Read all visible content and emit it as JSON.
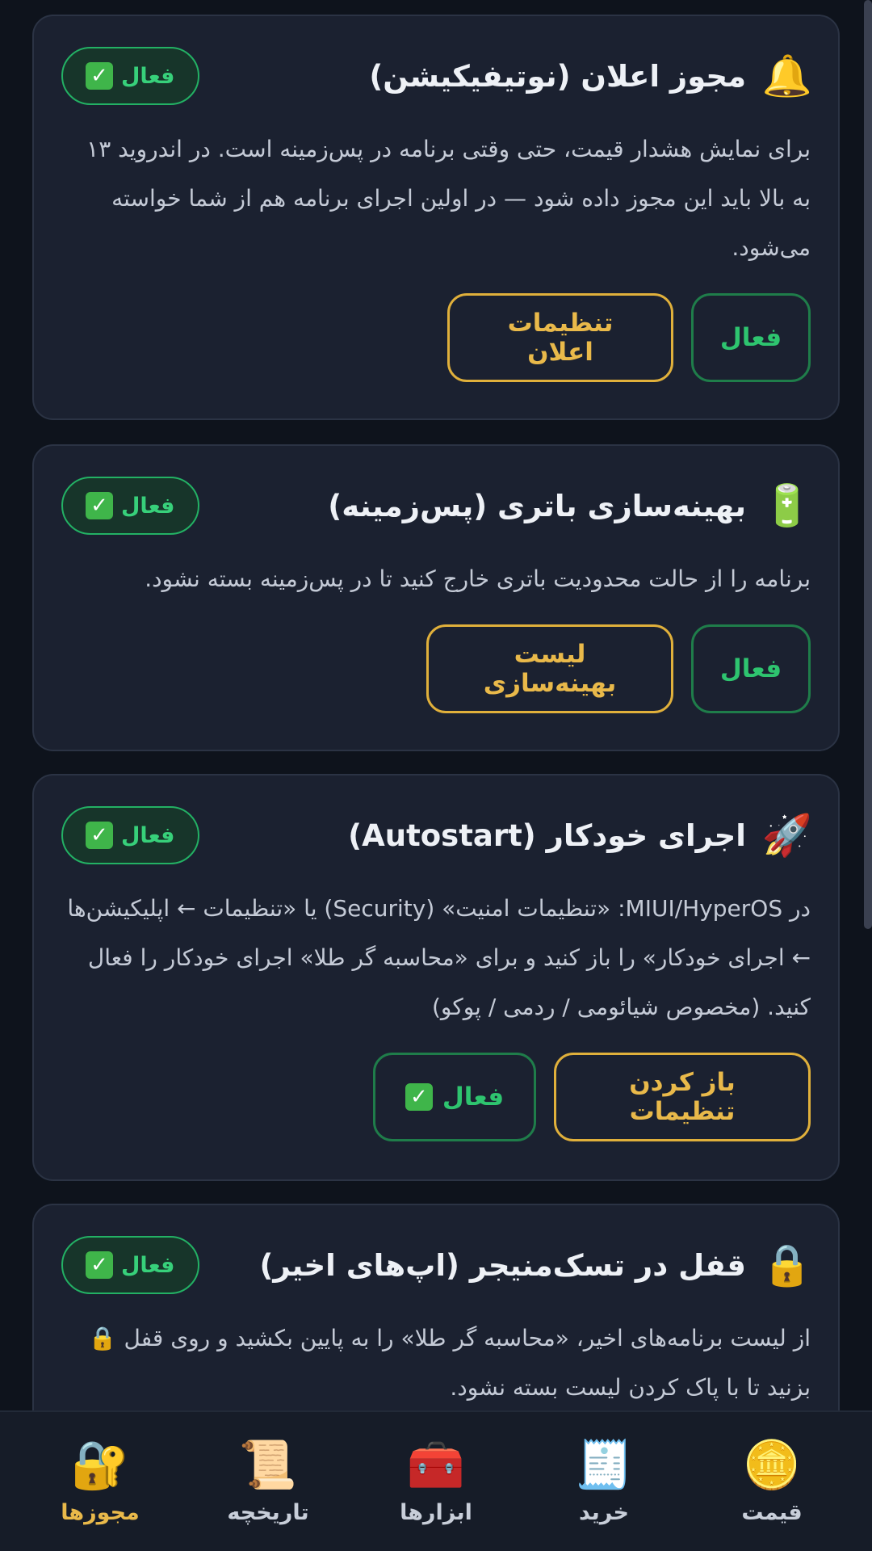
{
  "cards": [
    {
      "icon": "bell-icon",
      "icon_glyph": "🔔",
      "title": "مجوز اعلان (نوتیفیکیشن)",
      "badge": "فعال",
      "description": "برای نمایش هشدار قیمت، حتی وقتی برنامه در پس‌زمینه است. در اندروید ۱۳ به بالا باید این مجوز داده شود — در اولین اجرای برنامه هم از شما خواسته می‌شود.",
      "primary_button": "فعال",
      "secondary_button": "تنظیمات اعلان"
    },
    {
      "icon": "battery-icon",
      "icon_glyph": "🔋",
      "title": "بهینه‌سازی باتری (پس‌زمینه)",
      "badge": "فعال",
      "description": "برنامه را از حالت محدودیت باتری خارج کنید تا در پس‌زمینه بسته نشود.",
      "primary_button": "فعال",
      "secondary_button": "لیست بهینه‌سازی"
    },
    {
      "icon": "rocket-icon",
      "icon_glyph": "🚀",
      "title": "اجرای خودکار (Autostart)",
      "badge": "فعال",
      "description": "در MIUI/HyperOS: «تنظیمات امنیت» (Security) یا «تنظیمات ← اپلیکیشن‌ها ← اجرای خودکار» را باز کنید و برای «محاسبه گر طلا» اجرای خودکار را فعال کنید. (مخصوص شیائومی / ردمی / پوکو)",
      "primary_button": "باز کردن تنظیمات",
      "secondary_button": "فعال"
    },
    {
      "icon": "lock-icon",
      "icon_glyph": "🔒",
      "title": "قفل در تسک‌منیجر (اپ‌های اخیر)",
      "badge": "فعال",
      "description": "از لیست برنامه‌های اخیر، «محاسبه گر طلا» را به پایین بکشید و روی قفل 🔒 بزنید تا با پاک کردن لیست بسته نشود."
    }
  ],
  "nav": [
    {
      "label": "قیمت",
      "icon": "coin-icon",
      "glyph": "🪙"
    },
    {
      "label": "خرید",
      "icon": "receipt-icon",
      "glyph": "🧾"
    },
    {
      "label": "ابزارها",
      "icon": "toolbox-icon",
      "glyph": "🧰"
    },
    {
      "label": "تاریخچه",
      "icon": "scroll-icon",
      "glyph": "📜"
    },
    {
      "label": "مجوزها",
      "icon": "lock-key-icon",
      "glyph": "🔐"
    }
  ],
  "colors": {
    "background": "#0e131c",
    "card": "#1b2130",
    "accent_green": "#2ec46f",
    "accent_gold": "#e9b94a"
  }
}
